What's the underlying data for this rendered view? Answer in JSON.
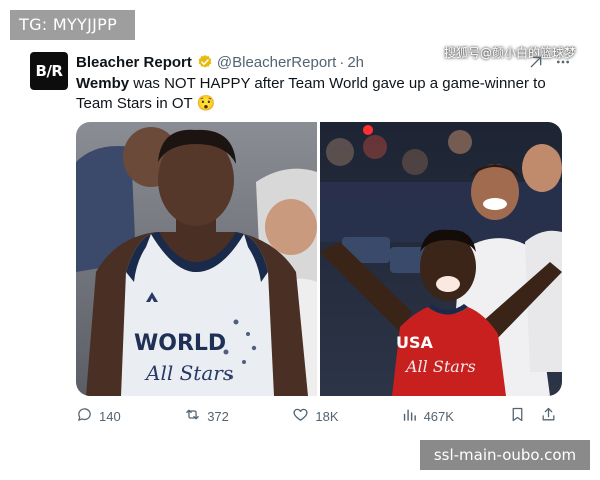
{
  "watermarks": {
    "top_left": "TG: MYYJJPP",
    "bottom_right": "ssl-main-oubo.com",
    "overlay": "搜狐号@颜小白的篮球梦"
  },
  "tweet": {
    "avatar_text": "B/R",
    "author_name": "Bleacher Report",
    "handle": "@BleacherReport",
    "separator": "·",
    "time": "2h",
    "text_bold": "Wemby",
    "text_rest": " was NOT HAPPY after Team World gave up a game-winner to Team Stars in OT",
    "emoji": "😯",
    "media_left": {
      "jersey_line1": "WORLD",
      "jersey_line2": "All Stars"
    },
    "media_right": {
      "jersey_line1": "USA",
      "jersey_line2": "All Stars"
    },
    "actions": {
      "replies": "140",
      "retweets": "372",
      "likes": "18K",
      "views": "467K"
    }
  },
  "colors": {
    "accent_verified": "#e8b90f",
    "muted_text": "#536471",
    "text": "#0f1419"
  }
}
